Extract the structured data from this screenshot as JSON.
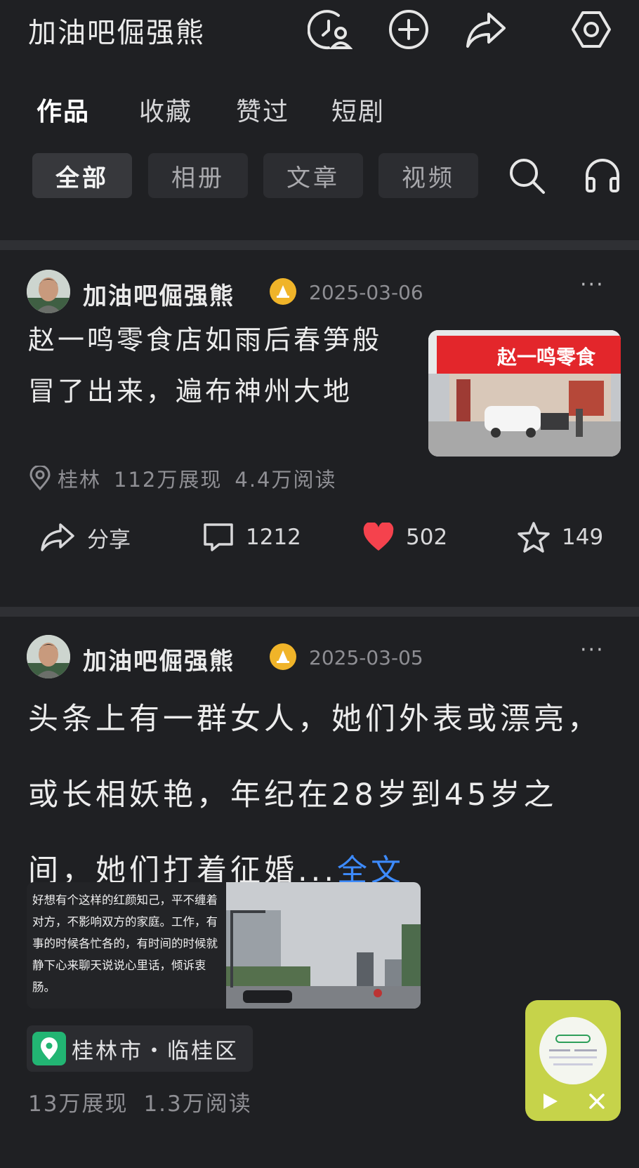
{
  "header": {
    "title": "加油吧倔强熊"
  },
  "tabs": [
    {
      "label": "作品"
    },
    {
      "label": "收藏"
    },
    {
      "label": "赞过"
    },
    {
      "label": "短剧"
    }
  ],
  "filters": [
    {
      "label": "全部"
    },
    {
      "label": "相册"
    },
    {
      "label": "文章"
    },
    {
      "label": "视频"
    }
  ],
  "posts": [
    {
      "author": "加油吧倔强熊",
      "date": "2025-03-06",
      "more": "···",
      "text": "赵一鸣零食店如雨后春笋般冒了出来，遍布神州大地",
      "thumbnail_sign": "赵一鸣零食",
      "location": "桂林",
      "views": "112万展现",
      "reads": "4.4万阅读",
      "share_label": "分享",
      "comments": "1212",
      "likes": "502",
      "favorites": "149"
    },
    {
      "author": "加油吧倔强熊",
      "date": "2025-03-05",
      "more": "···",
      "text": "头条上有一群女人，她们外表或漂亮，或长相妖艳，年纪在28岁到45岁之间，她们打着征婚...",
      "full_text_link": "全文",
      "image_quote": "好想有个这样的红颜知己，平不缠着对方，不影响双方的家庭。工作，有事的时候各忙各的，有时间的时候就静下心来聊天说说心里话，倾诉衷肠。",
      "location_chip": "桂林市・临桂区",
      "views": "13万展现",
      "reads": "1.3万阅读"
    }
  ],
  "colors": {
    "background": "#1f2023",
    "divider": "#2f3034",
    "link_blue": "#3d8bff",
    "like_red": "#f5424d",
    "verify_gold": "#f0b429",
    "location_green": "#22b573",
    "widget_yellow": "#c6d34a"
  },
  "icons": [
    "history-user-icon",
    "plus-circle-icon",
    "share-icon",
    "settings-icon",
    "search-icon",
    "headphones-icon",
    "location-pin-icon",
    "comment-icon",
    "heart-icon",
    "star-icon",
    "play-icon",
    "close-icon"
  ]
}
